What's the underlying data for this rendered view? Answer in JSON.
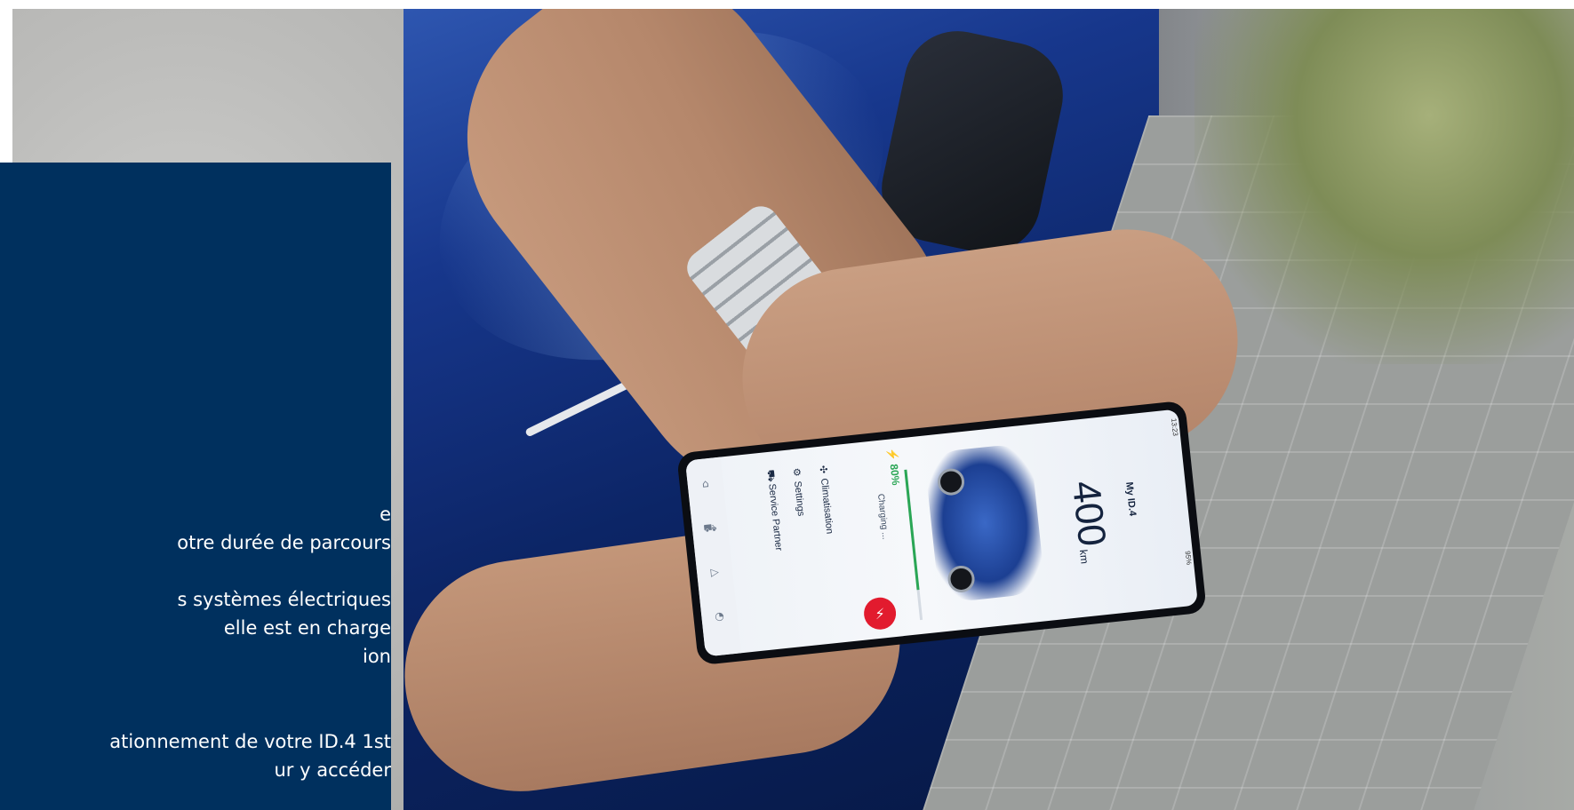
{
  "info_panel": {
    "lines": [
      "e",
      "otre durée de parcours",
      "",
      "s systèmes électriques",
      "elle est en charge",
      "ion",
      "",
      "",
      "ationnement de votre ID.4 1st",
      "ur y accéder"
    ]
  },
  "phone": {
    "status_time": "13:23",
    "status_battery": "95%",
    "vehicle_name": "My ID.4",
    "range_value": "400",
    "range_unit": "km",
    "charge_percent_label": "80%",
    "charge_level": 0.8,
    "charging_label": "Charging ...",
    "menu": [
      {
        "icon": "fan-icon",
        "glyph": "✣",
        "label": "Climatisation"
      },
      {
        "icon": "gear-icon",
        "glyph": "⚙",
        "label": "Settings"
      },
      {
        "icon": "car-service-icon",
        "glyph": "⛟",
        "label": "Service Partner"
      }
    ]
  },
  "colors": {
    "panel_bg": "#00305e",
    "charge_green": "#2aa655",
    "charge_button_red": "#e21b2e"
  }
}
